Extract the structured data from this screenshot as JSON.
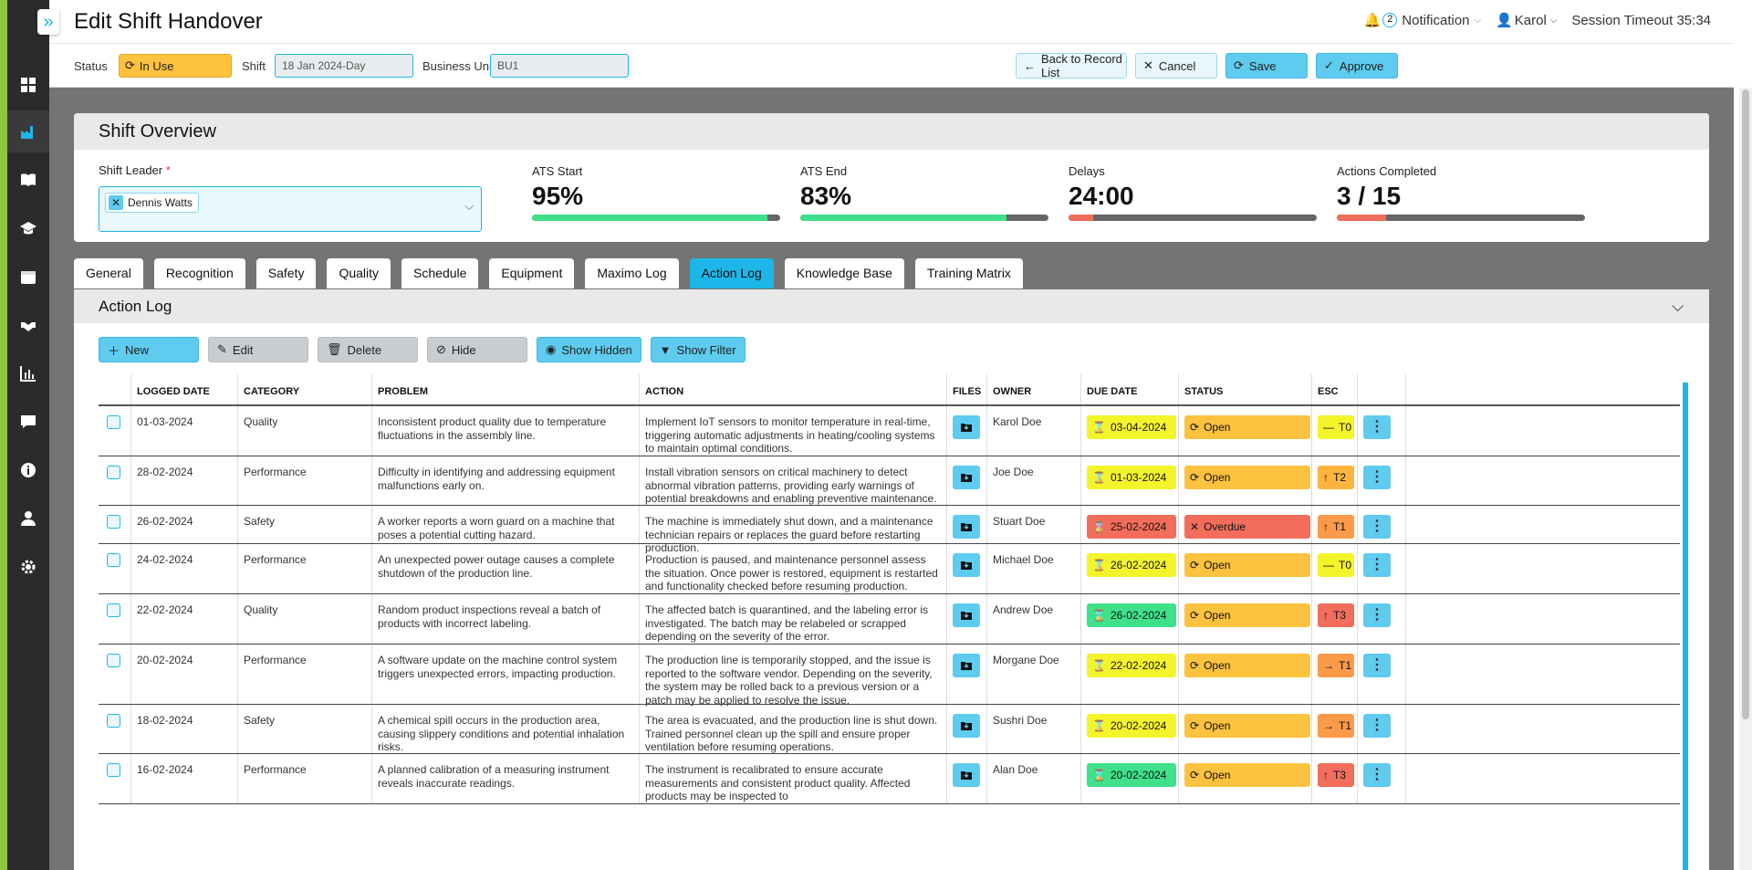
{
  "header": {
    "title": "Edit Shift Handover",
    "notification_count": "2",
    "notification_label": "Notification",
    "user": "Karol",
    "session_timeout": "Session Timeout 35:34"
  },
  "toolbar": {
    "status_label": "Status",
    "status_value": "In Use",
    "shift_label": "Shift",
    "shift_value": "18 Jan 2024-Day",
    "bu_label": "Business Unit",
    "bu_value": "BU1",
    "back_label": "Back to Record List",
    "cancel_label": "Cancel",
    "save_label": "Save",
    "approve_label": "Approve"
  },
  "overview": {
    "title": "Shift Overview",
    "leader_label": "Shift Leader",
    "leader_required": "*",
    "leader_value": "Dennis Watts",
    "kpis": [
      {
        "label": "ATS Start",
        "value": "95%",
        "fill": 0.95,
        "color": "#3ee18a"
      },
      {
        "label": "ATS End",
        "value": "83%",
        "fill": 0.83,
        "color": "#3ee18a"
      },
      {
        "label": "Delays",
        "value": "24:00",
        "fill": 0.1,
        "color": "#f26d5b"
      },
      {
        "label": "Actions Completed",
        "value": "3 / 15",
        "fill": 0.2,
        "color": "#f26d5b"
      }
    ]
  },
  "tabs": [
    "General",
    "Recognition",
    "Safety",
    "Quality",
    "Schedule",
    "Equipment",
    "Maximo Log",
    "Action Log",
    "Knowledge Base",
    "Training Matrix"
  ],
  "active_tab": "Action Log",
  "action_log": {
    "title": "Action Log",
    "buttons": {
      "new": "New",
      "edit": "Edit",
      "delete": "Delete",
      "hide": "Hide",
      "show_hidden": "Show Hidden",
      "show_filter": "Show Filter"
    },
    "columns": [
      "LOGGED DATE",
      "CATEGORY",
      "PROBLEM",
      "ACTION",
      "FILES",
      "OWNER",
      "DUE DATE",
      "STATUS",
      "ESC"
    ],
    "rows": [
      {
        "date": "01-03-2024",
        "category": "Quality",
        "problem": "Inconsistent product quality due to temperature fluctuations in the assembly line.",
        "action": "Implement IoT sensors to monitor temperature in real-time, triggering automatic adjustments in heating/cooling systems to maintain optimal conditions.",
        "owner": "Karol Doe",
        "due": "03-04-2024",
        "due_color": "#f4f42a",
        "status": "Open",
        "status_color": "#fdc23e",
        "esc": "T0",
        "esc_color": "#f4f42a",
        "esc_arrow": "—"
      },
      {
        "date": "28-02-2024",
        "category": "Performance",
        "problem": "Difficulty in identifying and addressing equipment malfunctions early on.",
        "action": "Install vibration sensors on critical machinery to detect abnormal vibration patterns, providing early warnings of potential breakdowns and enabling preventive maintenance.",
        "owner": "Joe Doe",
        "due": "01-03-2024",
        "due_color": "#f4f42a",
        "status": "Open",
        "status_color": "#fdc23e",
        "esc": "T2",
        "esc_color": "#fdb43e",
        "esc_arrow": "↑"
      },
      {
        "date": "26-02-2024",
        "category": "Safety",
        "problem": "A worker reports a worn guard on a machine that poses a potential cutting hazard.",
        "action": "The machine is immediately shut down, and a maintenance technician repairs or replaces the guard before restarting production.",
        "owner": "Stuart Doe",
        "due": "25-02-2024",
        "due_color": "#f26d5b",
        "status": "Overdue",
        "status_color": "#f26d5b",
        "esc": "T1",
        "esc_color": "#fd9a4a",
        "esc_arrow": "↑"
      },
      {
        "date": "24-02-2024",
        "category": "Performance",
        "problem": "An unexpected power outage causes a complete shutdown of the production line.",
        "action": "Production is paused, and maintenance personnel assess the situation. Once power is restored, equipment is restarted and functionality checked before resuming production.",
        "owner": "Michael Doe",
        "due": "26-02-2024",
        "due_color": "#f4f42a",
        "status": "Open",
        "status_color": "#fdc23e",
        "esc": "T0",
        "esc_color": "#f4f42a",
        "esc_arrow": "—"
      },
      {
        "date": "22-02-2024",
        "category": "Quality",
        "problem": "Random product inspections reveal a batch of products with incorrect labeling.",
        "action": "The affected batch is quarantined, and the labeling error is investigated. The batch may be relabeled or scrapped depending on the severity of the error.",
        "owner": "Andrew Doe",
        "due": "26-02-2024",
        "due_color": "#3ee18a",
        "status": "Open",
        "status_color": "#fdc23e",
        "esc": "T3",
        "esc_color": "#f26d5b",
        "esc_arrow": "↑"
      },
      {
        "date": "20-02-2024",
        "category": "Performance",
        "problem": "A software update on the machine control system triggers unexpected errors, impacting production.",
        "action": "The production line is temporarily stopped, and the issue is reported to the software vendor. Depending on the severity, the system may be rolled back to a previous version or a patch may be applied to resolve the issue.",
        "owner": "Morgane Doe",
        "due": "22-02-2024",
        "due_color": "#f4f42a",
        "status": "Open",
        "status_color": "#fdc23e",
        "esc": "T1",
        "esc_color": "#fd9a4a",
        "esc_arrow": "→"
      },
      {
        "date": "18-02-2024",
        "category": "Safety",
        "problem": "A chemical spill occurs in the production area, causing slippery conditions and potential inhalation risks.",
        "action": "The area is evacuated, and the production line is shut down. Trained personnel clean up the spill and ensure proper ventilation before resuming operations.",
        "owner": "Sushri Doe",
        "due": "20-02-2024",
        "due_color": "#f4f42a",
        "status": "Open",
        "status_color": "#fdc23e",
        "esc": "T1",
        "esc_color": "#fd9a4a",
        "esc_arrow": "→"
      },
      {
        "date": "16-02-2024",
        "category": "Performance",
        "problem": "A planned calibration of a measuring instrument reveals inaccurate readings.",
        "action": "The instrument is recalibrated to ensure accurate measurements and consistent product quality. Affected products may be inspected to",
        "owner": "Alan Doe",
        "due": "20-02-2024",
        "due_color": "#3ee18a",
        "status": "Open",
        "status_color": "#fdc23e",
        "esc": "T3",
        "esc_color": "#f26d5b",
        "esc_arrow": "↑"
      }
    ]
  }
}
